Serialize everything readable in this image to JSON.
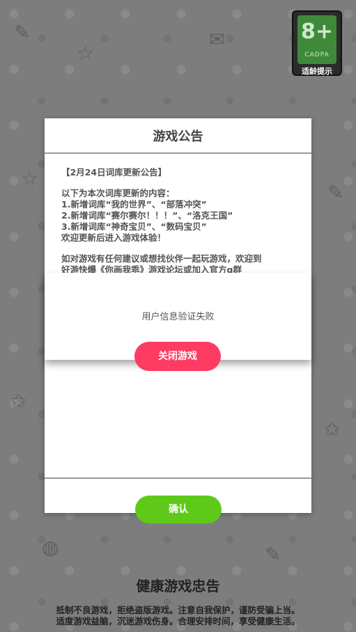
{
  "age_badge": {
    "rating": "8+",
    "org": "CADPA",
    "caption": "适龄提示"
  },
  "notice": {
    "title": "游戏公告",
    "heading": "【2月24日词库更新公告】",
    "intro": "以下为本次词库更新的内容：",
    "items": [
      "1.新增词库“我的世界”、“部落冲突”",
      "2.新增词库“赛尔赛尔！！！”、“洛克王国”",
      "3.新增词库“神奇宝贝”、“数码宝贝”"
    ],
    "welcome": "欢迎更新后进入游戏体验！",
    "feedback_line1": "如对游戏有任何建议或想找伙伴一起玩游戏，欢迎到",
    "feedback_line2": "好游快爆《你画我乖》游戏论坛或加入官方q群",
    "confirm_label": "确认"
  },
  "alert": {
    "message": "用户信息验证失败",
    "close_label": "关闭游戏"
  },
  "footer": {
    "title": "健康游戏忠告",
    "line1": "抵制不良游戏，拒绝盗版游戏。注意自我保护，谨防受骗上当。",
    "line2": "适度游戏益脑，沉迷游戏伤身。合理安排时间，享受健康生活。"
  },
  "colors": {
    "confirm_button": "#5fc91a",
    "close_button": "#ff3b62"
  }
}
